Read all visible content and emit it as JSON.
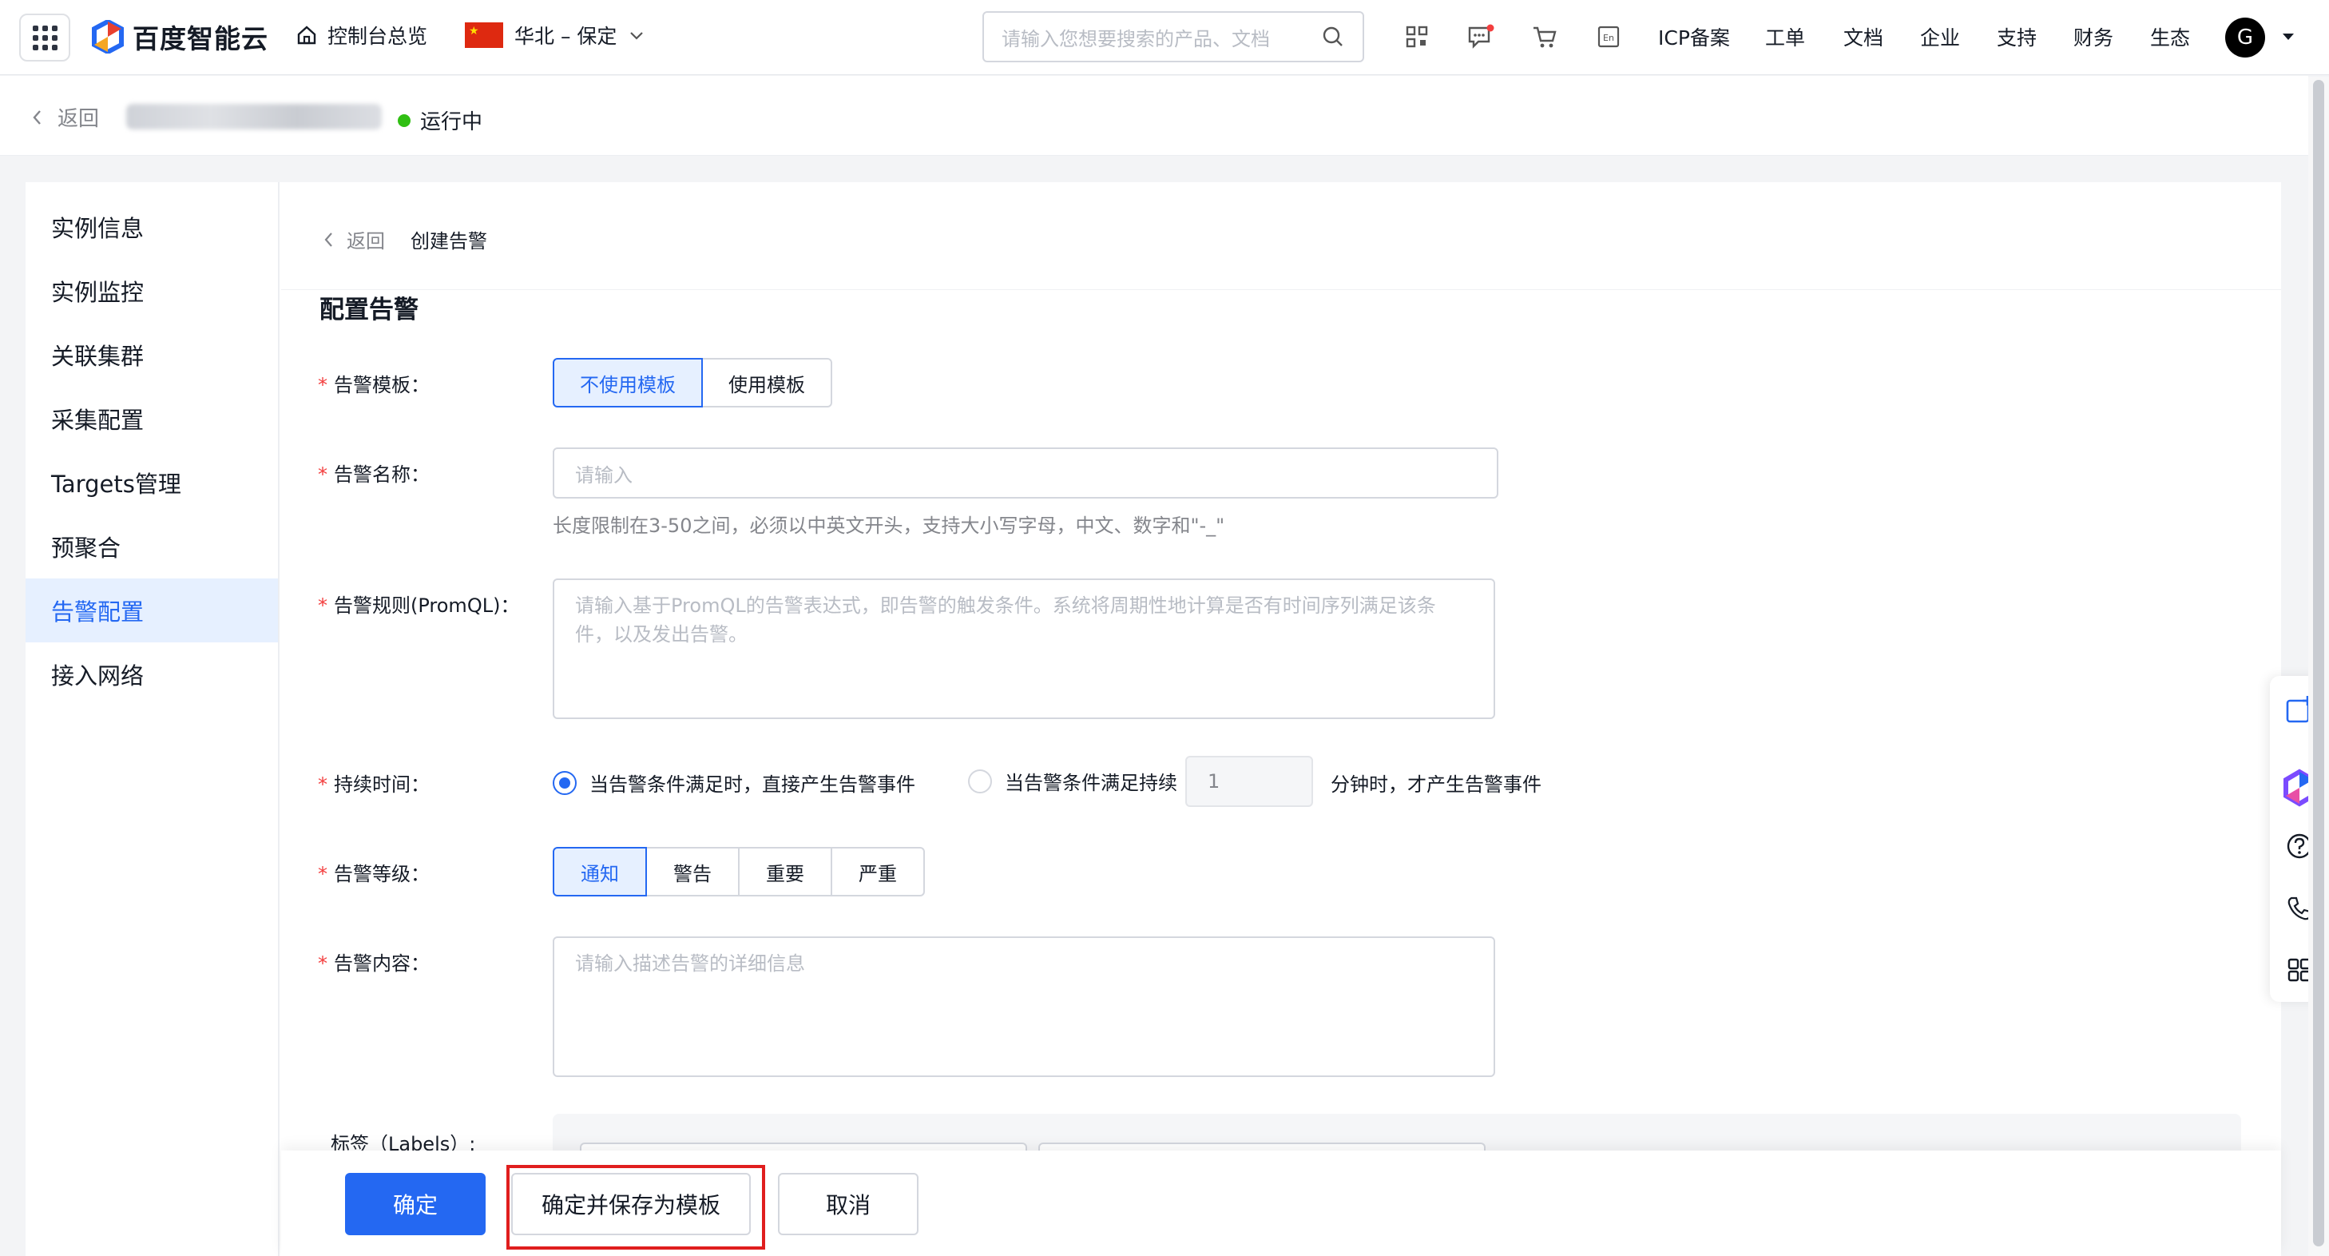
{
  "topbar": {
    "logo_text": "百度智能云",
    "console_label": "控制台总览",
    "region_label": "华北 – 保定",
    "search_placeholder": "请输入您想要搜索的产品、文档",
    "nav": [
      "ICP备案",
      "工单",
      "文档",
      "企业",
      "支持",
      "财务",
      "生态"
    ],
    "lang_label": "En",
    "avatar_letter": "G"
  },
  "subheader": {
    "back_label": "返回",
    "status": "运行中"
  },
  "sidebar": {
    "items": [
      "实例信息",
      "实例监控",
      "关联集群",
      "采集配置",
      "Targets管理",
      "预聚合",
      "告警配置",
      "接入网络"
    ],
    "active_index": 6
  },
  "breadcrumb": {
    "back": "返回",
    "current": "创建告警"
  },
  "form": {
    "title": "配置告警",
    "template_label": "告警模板：",
    "template_options": [
      "不使用模板",
      "使用模板"
    ],
    "template_selected": "不使用模板",
    "name_label": "告警名称：",
    "name_placeholder": "请输入",
    "name_hint": "长度限制在3-50之间，必须以中英文开头，支持大小写字母，中文、数字和\"-_\"",
    "rule_label": "告警规则(PromQL)：",
    "rule_placeholder": "请输入基于PromQL的告警表达式，即告警的触发条件。系统将周期性地计算是否有时间序列满足该条件，以及发出告警。",
    "duration_label": "持续时间：",
    "duration_option_1": "当告警条件满足时，直接产生告警事件",
    "duration_option_2_prefix": "当告警条件满足持续",
    "duration_value": "1",
    "duration_option_2_suffix": "分钟时，才产生告警事件",
    "duration_selected": 1,
    "level_label": "告警等级：",
    "level_options": [
      "通知",
      "警告",
      "重要",
      "严重"
    ],
    "level_selected": "通知",
    "content_label": "告警内容：",
    "content_placeholder": "请输入描述告警的详细信息",
    "labels_label": "标签（Labels）:"
  },
  "footer": {
    "confirm": "确定",
    "confirm_save_template": "确定并保存为模板",
    "cancel": "取消"
  },
  "colors": {
    "primary": "#2468f2",
    "required": "#f33e3e",
    "status_green": "#30bf13",
    "highlight_box": "#e01e1e"
  }
}
